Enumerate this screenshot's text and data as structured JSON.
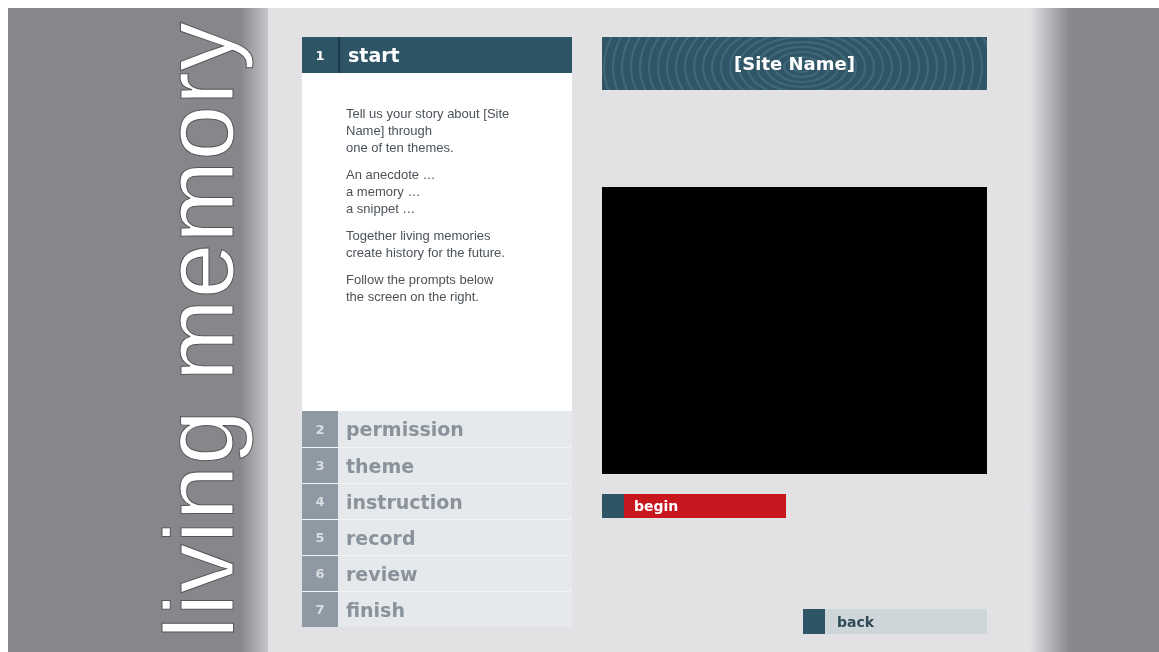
{
  "brand": "living memory",
  "steps": [
    {
      "number": "1",
      "label": "start",
      "selected": true
    },
    {
      "number": "2",
      "label": "permission",
      "selected": false
    },
    {
      "number": "3",
      "label": "theme",
      "selected": false
    },
    {
      "number": "4",
      "label": "instruction",
      "selected": false
    },
    {
      "number": "5",
      "label": "record",
      "selected": false
    },
    {
      "number": "6",
      "label": "review",
      "selected": false
    },
    {
      "number": "7",
      "label": "finish",
      "selected": false
    }
  ],
  "intro": [
    [
      "Tell us your story about [Site",
      "Name] through",
      "one of ten themes."
    ],
    [
      "An anecdote …",
      "a memory …",
      "a snippet …"
    ],
    [
      "Together living memories",
      "create history for the future."
    ],
    [
      "Follow the prompts below",
      "the screen on the right."
    ]
  ],
  "site_name": "[Site Name]",
  "begin_button": "begin",
  "back_button": "back"
}
